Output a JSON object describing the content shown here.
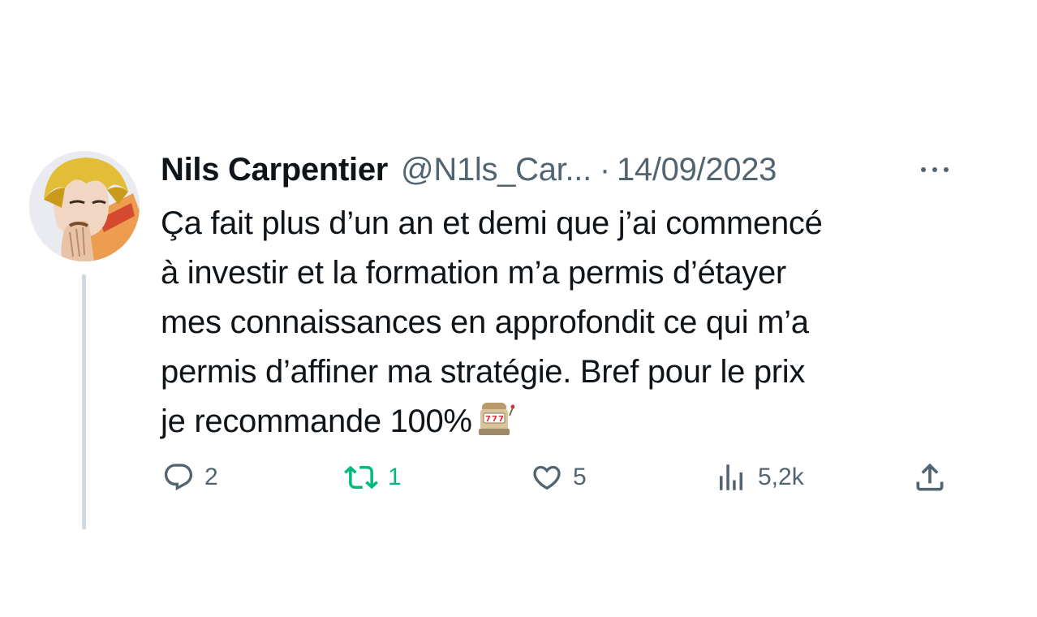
{
  "tweet": {
    "author": {
      "display_name": "Nils Carpentier",
      "handle": "@N1ls_Car...",
      "avatar_icon": "avatar-image"
    },
    "separator": "·",
    "date": "14/09/2023",
    "more_icon": "more-dots-icon",
    "text_lines": [
      "Ça fait plus d’un an et demi que j’ai commencé",
      "à investir et la formation m’a permis d’étayer",
      "mes connaissances en approfondit ce qui m’a",
      "permis d’affiner ma stratégie. Bref pour le prix",
      "je recommande 100%"
    ],
    "emoji": "slot-machine-emoji",
    "actions": {
      "reply": {
        "icon": "reply-icon",
        "count": "2"
      },
      "retweet": {
        "icon": "retweet-icon",
        "count": "1",
        "color": "#00ba7c"
      },
      "like": {
        "icon": "heart-icon",
        "count": "5"
      },
      "views": {
        "icon": "views-icon",
        "count": "5,2k"
      },
      "share": {
        "icon": "share-icon"
      }
    },
    "colors": {
      "text": "#0f1419",
      "secondary": "#536471",
      "thread_line": "#cfd9de",
      "retweet_active": "#00ba7c"
    }
  }
}
